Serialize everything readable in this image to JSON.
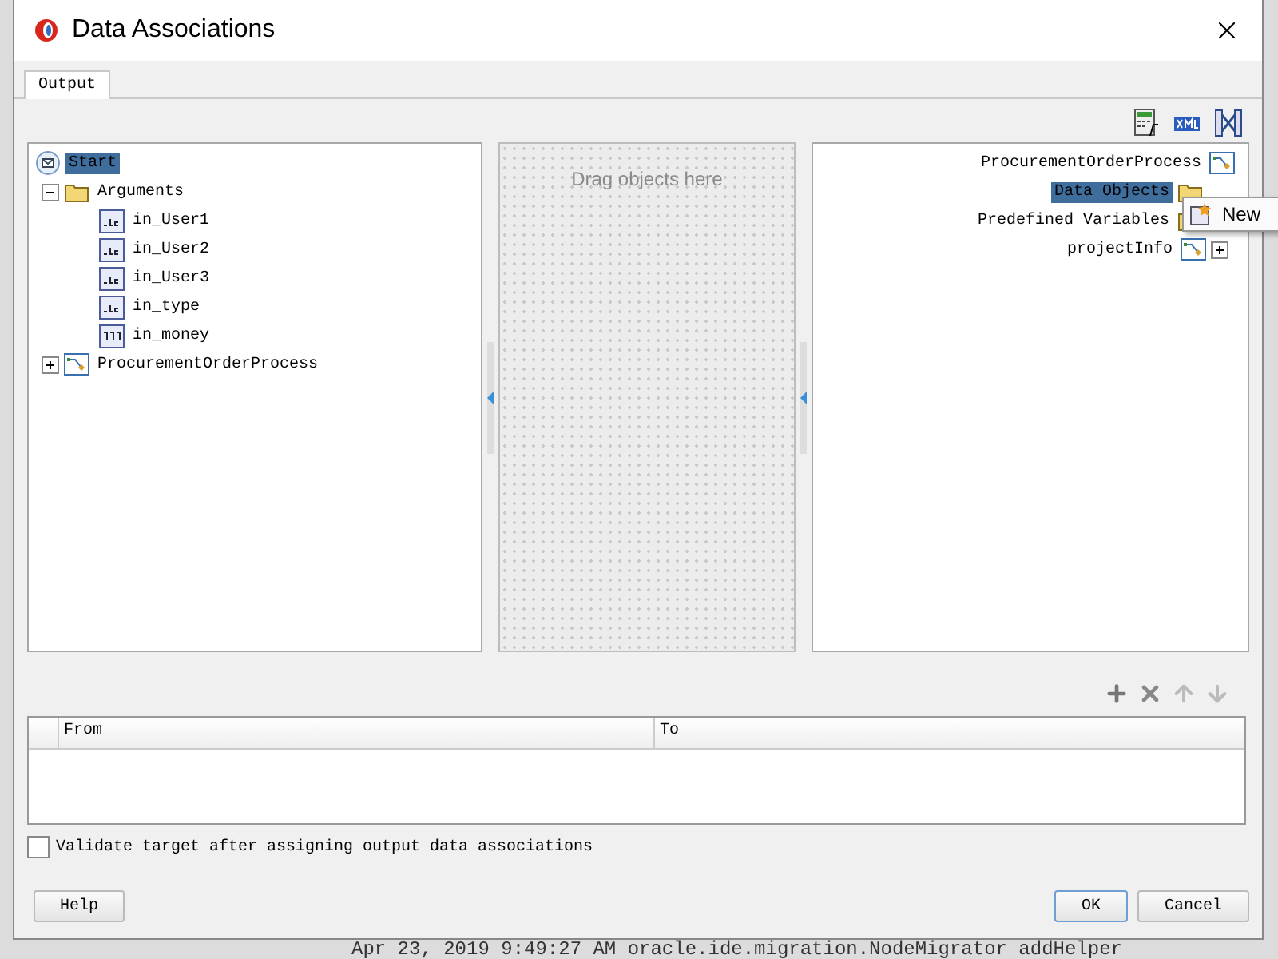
{
  "window": {
    "title": "Data Associations"
  },
  "tabs": [
    {
      "label": "Output",
      "selected": true
    }
  ],
  "source_tree": [
    {
      "label": "Start",
      "kind": "message",
      "selected": true,
      "children": [
        {
          "label": "Arguments",
          "kind": "folder",
          "selected": false,
          "expanded": true,
          "children": [
            {
              "label": "in_User1",
              "kind": "string",
              "selected": false
            },
            {
              "label": "in_User2",
              "kind": "string",
              "selected": false
            },
            {
              "label": "in_User3",
              "kind": "string",
              "selected": false
            },
            {
              "label": "in_type",
              "kind": "string",
              "selected": false
            },
            {
              "label": "in_money",
              "kind": "number",
              "selected": false
            }
          ]
        },
        {
          "label": "ProcurementOrderProcess",
          "kind": "process",
          "selected": false,
          "expanded": false
        }
      ]
    }
  ],
  "drop_area": {
    "hint": "Drag objects here"
  },
  "target_tree": [
    {
      "label": "ProcurementOrderProcess",
      "kind": "process",
      "selected": false,
      "children": [
        {
          "label": "Data Objects",
          "kind": "folder",
          "selected": true
        },
        {
          "label": "Predefined Variables",
          "kind": "folder",
          "selected": false
        },
        {
          "label": "projectInfo",
          "kind": "process",
          "selected": false,
          "expanded": false
        }
      ]
    }
  ],
  "context_menu": {
    "items": [
      "New"
    ]
  },
  "table": {
    "columns": [
      "From",
      "To"
    ]
  },
  "validate_option": {
    "label": "Validate target after assigning output data associations",
    "checked": false
  },
  "buttons": {
    "help": "Help",
    "ok": "OK",
    "cancel": "Cancel"
  },
  "background_log": "Apr 23, 2019 9:49:27 AM oracle.ide.migration.NodeMigrator addHelper"
}
